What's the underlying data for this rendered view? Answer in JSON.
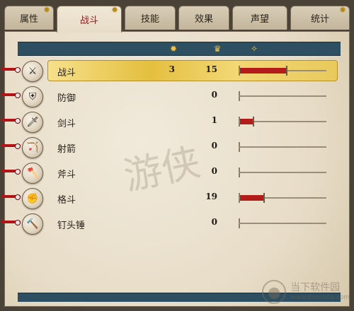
{
  "tabs": [
    {
      "label": "属性",
      "active": false,
      "star": true
    },
    {
      "label": "战斗",
      "active": true,
      "star": true
    },
    {
      "label": "技能",
      "active": false,
      "star": false
    },
    {
      "label": "效果",
      "active": false,
      "star": false
    },
    {
      "label": "声望",
      "active": false,
      "star": false
    },
    {
      "label": "统计",
      "active": false,
      "star": true
    }
  ],
  "top_icons": [
    {
      "name": "sun-icon",
      "glyph": "✹"
    },
    {
      "name": "crown-icon",
      "glyph": "♛"
    },
    {
      "name": "leaf-icon",
      "glyph": "✧"
    }
  ],
  "skills": [
    {
      "label": "战斗",
      "value_1": "3",
      "value_2": "15",
      "progress": 0.55,
      "highlight": true
    },
    {
      "label": "防御",
      "value_2": "0",
      "progress": 0.0
    },
    {
      "label": "剑斗",
      "value_2": "1",
      "progress": 0.15
    },
    {
      "label": "射箭",
      "value_2": "0",
      "progress": 0.0
    },
    {
      "label": "斧斗",
      "value_2": "0",
      "progress": 0.0
    },
    {
      "label": "格斗",
      "value_2": "19",
      "progress": 0.28
    },
    {
      "label": "钉头锤",
      "value_2": "0",
      "progress": 0.0
    }
  ],
  "watermark": {
    "text": "游侠"
  },
  "logo": {
    "text": "当下软件园",
    "subtext": "www.downxia.com"
  },
  "colors": {
    "accent": "#8b1e1e",
    "bar_fill": "#b41b1b",
    "top_bar": "#2d4f61",
    "highlight": "#e4bf3f"
  }
}
